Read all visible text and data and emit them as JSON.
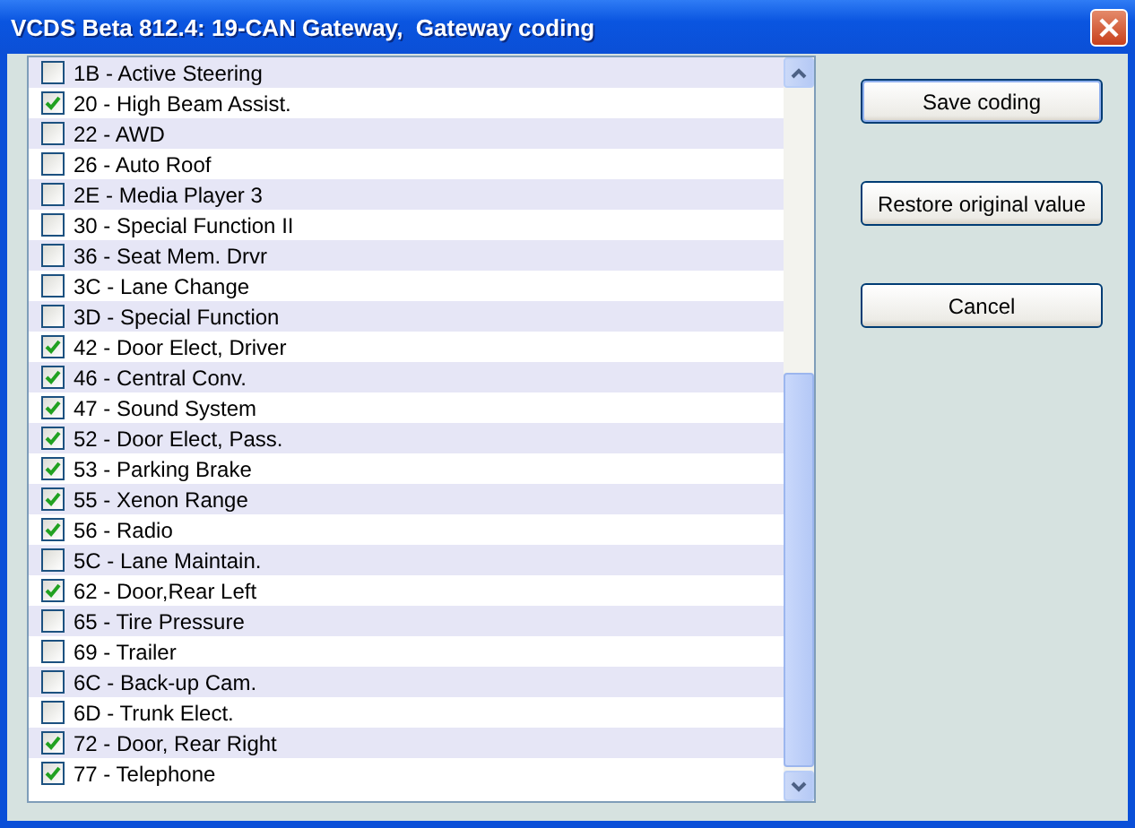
{
  "window": {
    "title": "VCDS Beta 812.4: 19-CAN Gateway,  Gateway coding"
  },
  "items": [
    {
      "label": "1B - Active Steering",
      "checked": false
    },
    {
      "label": "20 - High Beam Assist.",
      "checked": true
    },
    {
      "label": "22 - AWD",
      "checked": false
    },
    {
      "label": "26 - Auto Roof",
      "checked": false
    },
    {
      "label": "2E - Media Player 3",
      "checked": false
    },
    {
      "label": "30 - Special Function II",
      "checked": false
    },
    {
      "label": "36 - Seat Mem. Drvr",
      "checked": false
    },
    {
      "label": "3C - Lane Change",
      "checked": false
    },
    {
      "label": "3D - Special Function",
      "checked": false
    },
    {
      "label": "42 - Door Elect, Driver",
      "checked": true
    },
    {
      "label": "46 - Central Conv.",
      "checked": true
    },
    {
      "label": "47 - Sound System",
      "checked": true
    },
    {
      "label": "52 - Door Elect, Pass.",
      "checked": true
    },
    {
      "label": "53 - Parking Brake",
      "checked": true
    },
    {
      "label": "55 - Xenon Range",
      "checked": true
    },
    {
      "label": "56 - Radio",
      "checked": true
    },
    {
      "label": "5C - Lane Maintain.",
      "checked": false
    },
    {
      "label": "62 - Door,Rear Left",
      "checked": true
    },
    {
      "label": "65 - Tire Pressure",
      "checked": false
    },
    {
      "label": "69 - Trailer",
      "checked": false
    },
    {
      "label": "6C - Back-up Cam.",
      "checked": false
    },
    {
      "label": "6D - Trunk Elect.",
      "checked": false
    },
    {
      "label": "72 - Door, Rear Right",
      "checked": true
    },
    {
      "label": "77 - Telephone",
      "checked": true
    }
  ],
  "buttons": [
    "Save coding",
    "Restore original value",
    "Cancel"
  ]
}
